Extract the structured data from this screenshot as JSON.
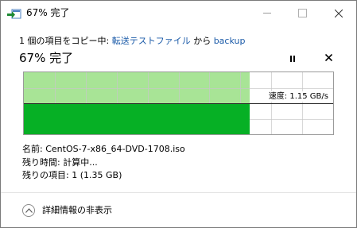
{
  "window": {
    "title": "67% 完了"
  },
  "copy_status": {
    "prefix": "1 個の項目をコピー中: ",
    "source": "転送テストファイル",
    "middle": " から ",
    "destination": "backup"
  },
  "progress": {
    "headline": "67% 完了",
    "percent": 67
  },
  "graph": {
    "speed_text": "速度: 1.15 GB/s",
    "colors": {
      "history_fill": "#a8e496",
      "current_fill": "#06b025",
      "grid": "#c8c8c8"
    }
  },
  "details": {
    "name_label": "名前:",
    "name_value": "CentOS-7-x86_64-DVD-1708.iso",
    "time_label": "残り時間:",
    "time_value": "計算中...",
    "items_label": "残りの項目:",
    "items_value": "1 (1.35 GB)"
  },
  "footer": {
    "toggle_label": "詳細情報の非表示"
  },
  "icons": [
    "copy-transfer-icon",
    "minimize-icon",
    "maximize-icon",
    "close-icon",
    "pause-icon",
    "stop-icon",
    "chevron-up-icon"
  ]
}
